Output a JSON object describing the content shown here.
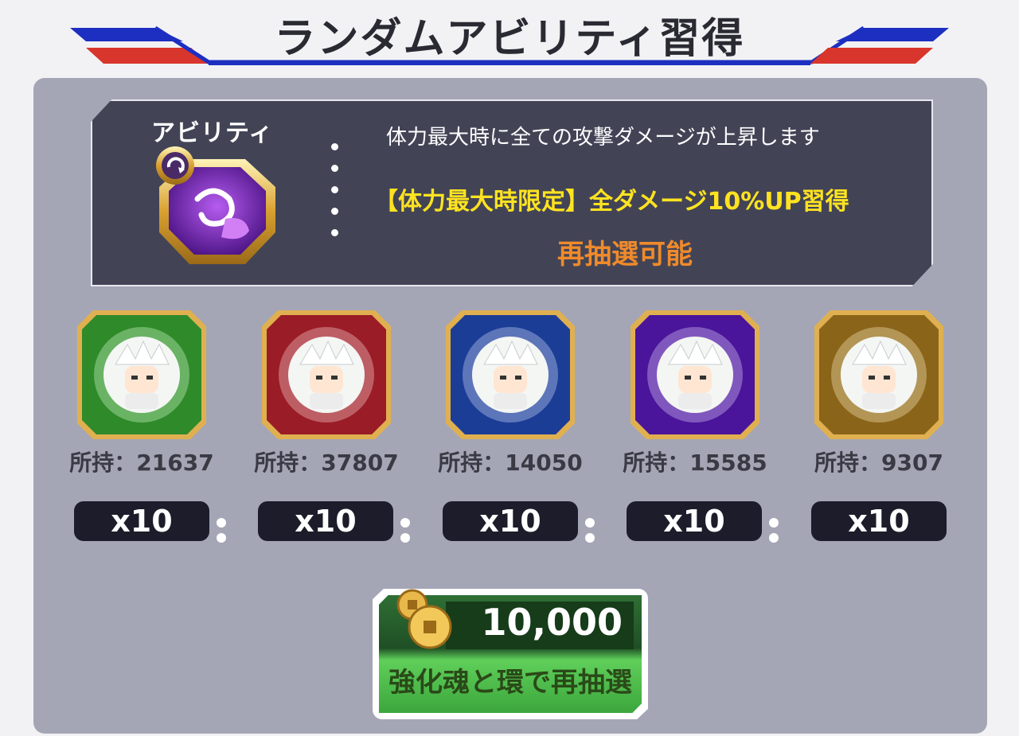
{
  "title": "ランダムアビリティ習得",
  "ability": {
    "label": "アビリティ",
    "icon": "ability-swirl-icon",
    "description": "体力最大時に全ての攻撃ダメージが上昇します",
    "effect": "【体力最大時限定】全ダメージ10%UP習得",
    "status": "再抽選可能"
  },
  "materials": [
    {
      "color": "#2f8a2a",
      "icon": "green-orb-icon",
      "owned": "所持：21637",
      "qty": "x10"
    },
    {
      "color": "#9a1c26",
      "icon": "red-orb-icon",
      "owned": "所持：37807",
      "qty": "x10"
    },
    {
      "color": "#1c3d96",
      "icon": "blue-orb-icon",
      "owned": "所持：14050",
      "qty": "x10"
    },
    {
      "color": "#4a159a",
      "icon": "purple-orb-icon",
      "owned": "所持：15585",
      "qty": "x10"
    },
    {
      "color": "#8a6418",
      "icon": "gold-orb-icon",
      "owned": "所持：9307",
      "qty": "x10"
    }
  ],
  "button": {
    "price": "10,000",
    "label": "強化魂と環で再抽選",
    "icon": "coins-icon"
  },
  "colors": {
    "panel": "#a4a6b6",
    "ability_box": "#424456",
    "effect_yellow": "#ffe320",
    "reroll_orange": "#f08a2b",
    "stripe_blue": "#1d2fc0",
    "stripe_red": "#d8352c"
  }
}
